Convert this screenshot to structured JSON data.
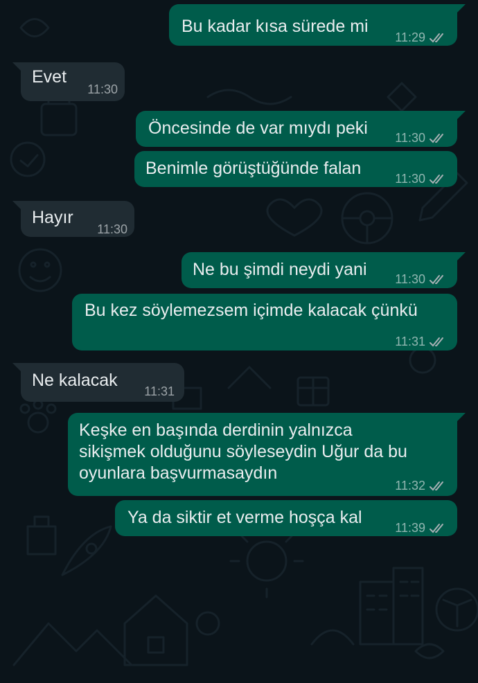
{
  "messages": [
    {
      "direction": "out",
      "text": "Bu kadar kısa sürede mi",
      "time": "11:29",
      "status": "read-ticks-icon"
    },
    {
      "direction": "in",
      "text": "Evet",
      "time": "11:30"
    },
    {
      "direction": "out",
      "text": "Öncesinde de var mıydı peki",
      "time": "11:30",
      "status": "read-ticks-icon"
    },
    {
      "direction": "out",
      "text": "Benimle görüştüğünde falan",
      "time": "11:30",
      "status": "read-ticks-icon"
    },
    {
      "direction": "in",
      "text": "Hayır",
      "time": "11:30"
    },
    {
      "direction": "out",
      "text": "Ne bu şimdi neydi yani",
      "time": "11:30",
      "status": "read-ticks-icon"
    },
    {
      "direction": "out",
      "text": "Bu kez söylemezsem içimde kalacak çünkü",
      "time": "11:31",
      "status": "read-ticks-icon"
    },
    {
      "direction": "in",
      "text": "Ne kalacak",
      "time": "11:31"
    },
    {
      "direction": "out",
      "text": "Keşke en başında derdinin yalnızca\nsikişmek olduğunu söyleseydin Uğur da bu\noyunlara başvurmasaydın",
      "time": "11:32",
      "status": "read-ticks-icon"
    },
    {
      "direction": "out",
      "text": "Ya da siktir et verme hoşça kal",
      "time": "11:39",
      "status": "read-ticks-icon"
    }
  ],
  "colors": {
    "background": "#0b141a",
    "outgoing_bubble": "#005c4b",
    "incoming_bubble": "#202c33",
    "text": "#e9edef",
    "meta_text": "#a9b1b5"
  }
}
